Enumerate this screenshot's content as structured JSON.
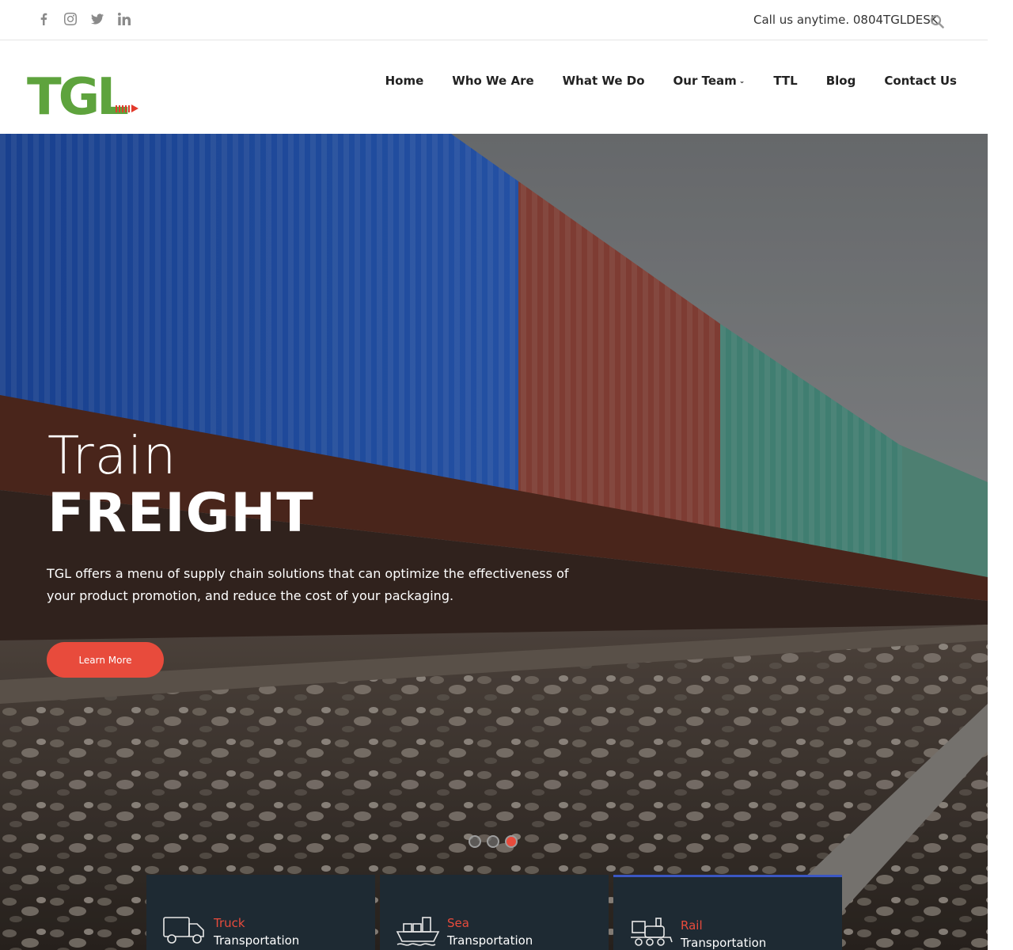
{
  "topbar": {
    "socials": [
      {
        "icon": "facebook-icon",
        "glyph": "f"
      },
      {
        "icon": "instagram-icon",
        "glyph": ""
      },
      {
        "icon": "twitter-icon",
        "glyph": ""
      },
      {
        "icon": "linkedin-icon",
        "glyph": "in"
      }
    ],
    "call_text": "Call us anytime. 0804TGLDESK",
    "search_icon": "search-icon"
  },
  "header": {
    "logo_text": "TGL",
    "nav": [
      {
        "label": "Home"
      },
      {
        "label": "Who We Are"
      },
      {
        "label": "What We Do"
      },
      {
        "label": "Our Team",
        "has_dropdown": true
      },
      {
        "label": "TTL"
      },
      {
        "label": "Blog"
      },
      {
        "label": "Contact Us"
      }
    ]
  },
  "hero": {
    "title_light": "Train",
    "title_bold": "FREIGHT",
    "description": "TGL offers a menu of supply chain solutions that can optimize the effectiveness of your product promotion, and reduce the cost of your packaging.",
    "button_label": "Learn More",
    "slides_total": 3,
    "active_slide": 3
  },
  "services": [
    {
      "accent": "Truck",
      "label": "Transportation",
      "icon": "truck-icon"
    },
    {
      "accent": "Sea",
      "label": "Transportation",
      "icon": "ship-icon"
    },
    {
      "accent": "Rail",
      "label": "Transportation",
      "icon": "train-icon",
      "active": true
    }
  ],
  "colors": {
    "brand_green": "#5ea33d",
    "accent_red": "#e84b3c",
    "card_bg": "#1e2a33",
    "card_active_border": "#3b57c4"
  }
}
